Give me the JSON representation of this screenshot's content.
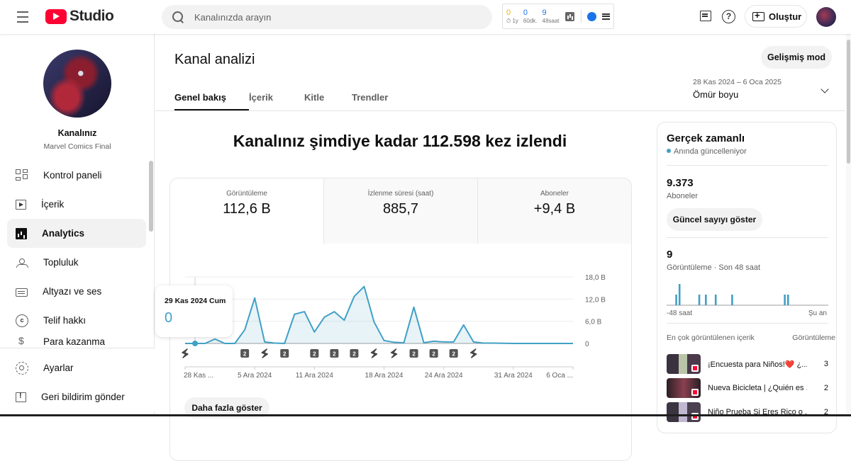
{
  "app": {
    "brand": "Studio",
    "accent_color": "#ff0033",
    "chart_color": "#41a0c6"
  },
  "search": {
    "placeholder": "Kanalınızda arayın",
    "value": ""
  },
  "extension": {
    "stats": [
      {
        "value": "0",
        "label": "⏱ 1y",
        "color": "#f2b400"
      },
      {
        "value": "0",
        "label": "60dk.",
        "color": "#1a73e8"
      },
      {
        "value": "9",
        "label": "48saat",
        "color": "#1a73e8"
      }
    ]
  },
  "topbar": {
    "create_label": "Oluştur"
  },
  "channel": {
    "title": "Kanalınız",
    "name": "Marvel Comics Final"
  },
  "sidebar": {
    "items": [
      {
        "label": "Kontrol paneli",
        "icon": "dashboard-icon"
      },
      {
        "label": "İçerik",
        "icon": "content-icon"
      },
      {
        "label": "Analytics",
        "icon": "analytics-icon",
        "active": true
      },
      {
        "label": "Topluluk",
        "icon": "community-icon"
      },
      {
        "label": "Altyazı ve ses",
        "icon": "subtitles-icon"
      },
      {
        "label": "Telif hakkı",
        "icon": "copyright-icon"
      },
      {
        "label": "Para kazanma",
        "icon": "monetization-icon"
      }
    ],
    "bottom": [
      {
        "label": "Ayarlar",
        "icon": "settings-icon"
      },
      {
        "label": "Geri bildirim gönder",
        "icon": "feedback-icon"
      }
    ]
  },
  "main": {
    "title": "Kanal analizi",
    "advanced_label": "Gelişmiş mod",
    "tabs": [
      {
        "label": "Genel bakış",
        "active": true
      },
      {
        "label": "İçerik"
      },
      {
        "label": "Kitle"
      },
      {
        "label": "Trendler"
      }
    ],
    "date_range": {
      "range": "28 Kas 2024 – 6 Oca 2025",
      "label": "Ömür boyu"
    },
    "headline": "Kanalınız şimdiye kadar 112.598 kez izlendi",
    "kpis": [
      {
        "label": "Görüntüleme",
        "value": "112,6 B",
        "active": true
      },
      {
        "label": "İzlenme süresi (saat)",
        "value": "885,7"
      },
      {
        "label": "Aboneler",
        "value": "+9,4 B"
      }
    ],
    "tooltip": {
      "date": "29 Kas 2024 Cum",
      "value": "0"
    },
    "more_label": "Daha fazla göster"
  },
  "chart_data": {
    "type": "area",
    "title": "Görüntüleme",
    "x": [
      "28 Kas",
      "29 Kas",
      "30 Kas",
      "1 Ara",
      "2 Ara",
      "3 Ara",
      "4 Ara",
      "5 Ara",
      "6 Ara",
      "7 Ara",
      "8 Ara",
      "9 Ara",
      "10 Ara",
      "11 Ara",
      "12 Ara",
      "13 Ara",
      "14 Ara",
      "15 Ara",
      "16 Ara",
      "17 Ara",
      "18 Ara",
      "19 Ara",
      "20 Ara",
      "21 Ara",
      "22 Ara",
      "23 Ara",
      "24 Ara",
      "25 Ara",
      "26 Ara",
      "27 Ara",
      "28 Ara",
      "29 Ara",
      "30 Ara",
      "31 Ara",
      "1 Oca",
      "2 Oca",
      "3 Oca",
      "4 Oca",
      "5 Oca",
      "6 Oca"
    ],
    "series": [
      {
        "name": "Görüntüleme",
        "values": [
          0,
          0,
          0,
          1.2,
          0,
          0,
          3.7,
          12.3,
          0.4,
          0.1,
          0,
          7.9,
          8.6,
          3.1,
          7.1,
          8.6,
          6.3,
          12.7,
          15.4,
          5.8,
          0.8,
          0.3,
          0.2,
          9.8,
          0.2,
          0.6,
          0.4,
          0.4,
          5.0,
          0.4,
          0.1,
          0.1,
          0.05,
          0,
          0,
          0,
          0,
          0,
          0,
          0
        ]
      }
    ],
    "unit": "thousand",
    "ylim": [
      0,
      18
    ],
    "y_ticks": [
      "0",
      "6,0 B",
      "12,0 B",
      "18,0 B"
    ],
    "y_tick_values": [
      0,
      6,
      12,
      18
    ],
    "x_tick_labels": [
      {
        "label": "28 Kas ...",
        "index": 0
      },
      {
        "label": "5 Ara 2024",
        "index": 7
      },
      {
        "label": "11 Ara 2024",
        "index": 13
      },
      {
        "label": "18 Ara 2024",
        "index": 20
      },
      {
        "label": "24 Ara 2024",
        "index": 26
      },
      {
        "label": "31 Ara 2024",
        "index": 33
      },
      {
        "label": "6 Oca ...",
        "index": 39
      }
    ],
    "markers": [
      {
        "index": 0,
        "type": "short"
      },
      {
        "index": 6,
        "type": "count",
        "label": "2"
      },
      {
        "index": 8,
        "type": "short"
      },
      {
        "index": 10,
        "type": "count",
        "label": "2"
      },
      {
        "index": 13,
        "type": "count",
        "label": "2"
      },
      {
        "index": 15,
        "type": "count",
        "label": "2"
      },
      {
        "index": 17,
        "type": "count",
        "label": "2"
      },
      {
        "index": 19,
        "type": "short"
      },
      {
        "index": 21,
        "type": "short"
      },
      {
        "index": 23,
        "type": "count",
        "label": "2"
      },
      {
        "index": 25,
        "type": "count",
        "label": "2"
      },
      {
        "index": 27,
        "type": "count",
        "label": "2"
      },
      {
        "index": 29,
        "type": "short"
      }
    ],
    "highlight_index": 1,
    "grid": true
  },
  "realtime": {
    "title": "Gerçek zamanlı",
    "live_label": "Anında güncelleniyor",
    "subscribers": "9.373",
    "subscribers_label": "Aboneler",
    "show_count_label": "Güncel sayıyı göster",
    "views": "9",
    "views_label": "Görüntüleme · Son 48 saat",
    "axis_start": "-48 saat",
    "axis_end": "Şu an",
    "hourly_views": [
      0,
      0,
      1,
      2,
      0,
      0,
      0,
      0,
      0,
      1,
      0,
      1,
      0,
      0,
      1,
      0,
      0,
      0,
      0,
      1,
      0,
      0,
      0,
      0,
      0,
      0,
      0,
      0,
      0,
      0,
      0,
      0,
      0,
      0,
      0,
      1,
      1,
      0,
      0,
      0,
      0,
      0,
      0,
      0,
      0,
      0,
      0,
      0
    ],
    "top_content_label": "En çok görüntülenen içerik",
    "top_content_metric": "Görüntüleme",
    "top_content": [
      {
        "title": "¡Encuesta para Niños!❤️ ¿...",
        "views": "3"
      },
      {
        "title": "Nueva Bicicleta | ¿Quién es ...",
        "views": "2"
      },
      {
        "title": "Niño Prueba Si Eres Rico o ...",
        "views": "2"
      }
    ]
  }
}
